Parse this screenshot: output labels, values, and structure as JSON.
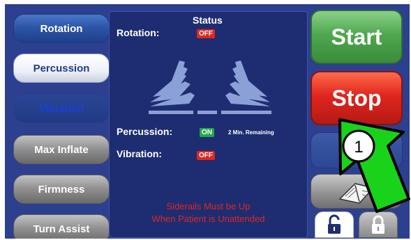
{
  "menu": {
    "rotation": "Rotation",
    "percussion": "Percussion",
    "vibration": "Vibration",
    "max_inflate": "Max Inflate",
    "firmness": "Firmness",
    "turn_assist": "Turn Assist"
  },
  "status": {
    "title": "Status",
    "rotation_label": "Rotation:",
    "rotation_state": "OFF",
    "percussion_label": "Percussion:",
    "percussion_state": "ON",
    "percussion_remaining": "2 Min. Remaining",
    "vibration_label": "Vibration:",
    "vibration_state": "OFF",
    "warning_line1": "Siderails Must be Up",
    "warning_line2": "When Patient is Unattended"
  },
  "controls": {
    "start": "Start",
    "stop": "Stop"
  },
  "callout": {
    "number": "1"
  },
  "icons": {
    "manual": "manual-icon",
    "lock_open": "unlock-icon",
    "lock_closed": "lock-icon",
    "bed": "bed-position-icon"
  },
  "colors": {
    "screen_bg": "#2d3f8f",
    "panel_bg": "#1e2d72",
    "off_badge": "#e0261f",
    "on_badge": "#22a84a",
    "warning_text": "#e0261f",
    "start_green": "#4fa84f",
    "stop_red": "#e0261f",
    "callout_green": "#18d31a"
  }
}
